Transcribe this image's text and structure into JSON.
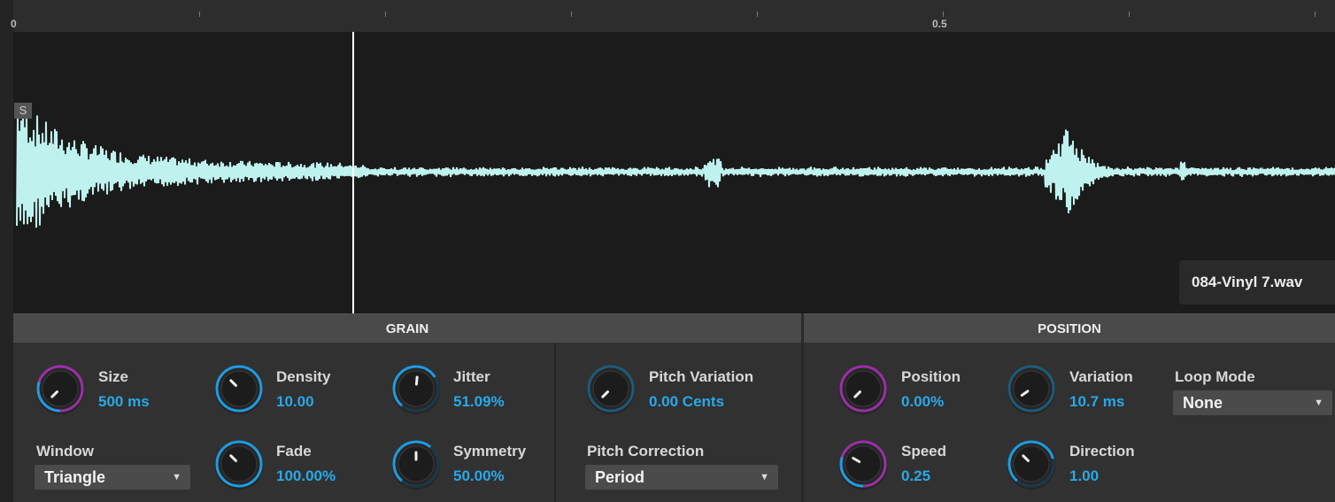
{
  "ruler": {
    "start_label": "0",
    "mid_label": "0.5"
  },
  "waveform": {
    "start_marker": "S",
    "file_name": "084-Vinyl 7.wav",
    "wave_color": "#bff2ee",
    "playhead_color": "#ffffff"
  },
  "grain": {
    "title": "GRAIN",
    "size": {
      "label": "Size",
      "value": "500 ms"
    },
    "density": {
      "label": "Density",
      "value": "10.00"
    },
    "jitter": {
      "label": "Jitter",
      "value": "51.09%"
    },
    "window": {
      "label": "Window",
      "value": "Triangle"
    },
    "fade": {
      "label": "Fade",
      "value": "100.00%"
    },
    "symmetry": {
      "label": "Symmetry",
      "value": "50.00%"
    },
    "pitch_variation": {
      "label": "Pitch Variation",
      "value": "0.00 Cents"
    },
    "pitch_correction": {
      "label": "Pitch Correction",
      "value": "Period"
    }
  },
  "position": {
    "title": "POSITION",
    "position": {
      "label": "Position",
      "value": "0.00%"
    },
    "variation": {
      "label": "Variation",
      "value": "10.7 ms"
    },
    "loop_mode": {
      "label": "Loop Mode",
      "value": "None"
    },
    "speed": {
      "label": "Speed",
      "value": "0.25"
    },
    "direction": {
      "label": "Direction",
      "value": "1.00"
    }
  },
  "colors": {
    "value_text": "#29a8e8",
    "knob_ring_blue": "#1e9be0",
    "knob_ring_purple": "#9b2fa8",
    "background": "#2b2b2b"
  }
}
